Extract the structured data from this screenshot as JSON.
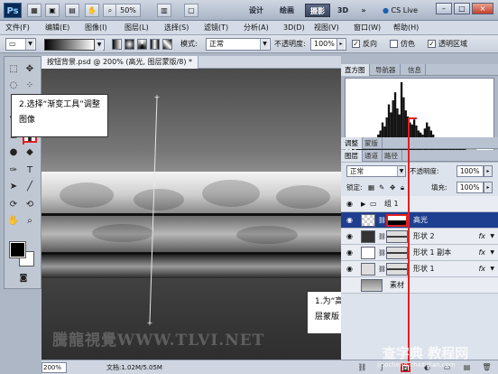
{
  "app": {
    "logo": "Ps",
    "zoom": "50%",
    "workspaces": [
      "设计",
      "绘画",
      "摄影",
      "3D"
    ],
    "active_workspace": "摄影",
    "more": "»",
    "cs_live": "CS Live",
    "win_min": "–",
    "win_max": "□",
    "win_close": "×"
  },
  "menu": [
    "文件(F)",
    "编辑(E)",
    "图像(I)",
    "图层(L)",
    "选择(S)",
    "滤镜(T)",
    "分析(A)",
    "3D(D)",
    "视图(V)",
    "窗口(W)",
    "帮助(H)"
  ],
  "options": {
    "mode_label": "模式:",
    "mode_value": "正常",
    "opacity_label": "不透明度:",
    "opacity_value": "100%",
    "reverse": "反向",
    "dither": "仿色",
    "transparency": "透明区域"
  },
  "document": {
    "tab_title": "按钮背景.psd @ 200% (高光, 图层蒙版/8) *",
    "zoom": "200%",
    "info": "文档:1.02M/5.05M"
  },
  "callouts": {
    "step2": "2.选择“渐变工具”调整图像",
    "step1": "1.为“高光”图层添加图层蒙版"
  },
  "watermark": "騰龍視覺WWW.TLVI.NET",
  "site_mark": "查字典 教程网",
  "site_url": "jiaocheng.chazidian.com",
  "panels": {
    "histogram_tabs": [
      "直方图",
      "导航器",
      "信息"
    ],
    "adjust_tabs": [
      "调整",
      "蒙版"
    ],
    "layer_tabs": [
      "图层",
      "通道",
      "路径"
    ],
    "blend_mode": "正常",
    "opacity_label": "不透明度:",
    "opacity_value": "100%",
    "lock_label": "锁定:",
    "fill_label": "填充:",
    "fill_value": "100%"
  },
  "layers": [
    {
      "name": "组 1",
      "type": "group"
    },
    {
      "name": "高光",
      "type": "mask",
      "selected": true
    },
    {
      "name": "形状 2",
      "type": "shape",
      "fx": "fx"
    },
    {
      "name": "形状 1 副本",
      "type": "shape",
      "fx": "fx"
    },
    {
      "name": "形状 1",
      "type": "shape",
      "fx": "fx"
    },
    {
      "name": "素材",
      "type": "image"
    }
  ],
  "histogram_values": [
    2,
    3,
    2,
    4,
    3,
    5,
    4,
    6,
    5,
    7,
    8,
    9,
    10,
    12,
    14,
    18,
    22,
    30,
    26,
    35,
    48,
    40,
    52,
    60,
    44,
    38,
    70,
    55,
    42,
    36,
    30,
    28,
    33,
    27,
    22,
    20,
    18,
    24,
    30,
    26,
    22,
    18,
    15,
    13,
    12,
    10,
    9,
    8,
    8,
    7,
    6,
    6,
    5,
    5,
    4,
    4,
    4,
    3,
    3,
    3,
    3,
    3,
    2,
    2,
    2,
    2,
    2,
    2,
    2,
    1
  ]
}
